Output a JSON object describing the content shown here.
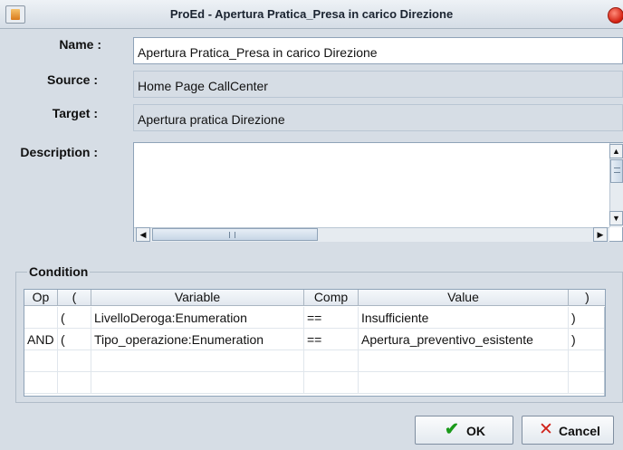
{
  "window": {
    "title": "ProEd - Apertura Pratica_Presa in carico Direzione",
    "icon": "java-cup-icon"
  },
  "form": {
    "name_label": "Name :",
    "name_value": "Apertura Pratica_Presa in carico Direzione",
    "source_label": "Source :",
    "source_value": "Home Page CallCenter",
    "target_label": "Target :",
    "target_value": "Apertura pratica Direzione",
    "description_label": "Description :",
    "description_value": ""
  },
  "condition": {
    "title": "Condition",
    "columns": [
      "Op",
      "(",
      "Variable",
      "Comp",
      "Value",
      ")"
    ],
    "rows": [
      {
        "op": "",
        "open": "(",
        "variable": "LivelloDeroga:Enumeration",
        "comp": "==",
        "value": "Insufficiente",
        "close": ")"
      },
      {
        "op": "AND",
        "open": "(",
        "variable": "Tipo_operazione:Enumeration",
        "comp": "==",
        "value": "Apertura_preventivo_esistente",
        "close": ")"
      },
      {
        "op": "",
        "open": "",
        "variable": "",
        "comp": "",
        "value": "",
        "close": ""
      },
      {
        "op": "",
        "open": "",
        "variable": "",
        "comp": "",
        "value": "",
        "close": ""
      }
    ]
  },
  "buttons": {
    "ok_label": "OK",
    "cancel_label": "Cancel"
  },
  "colors": {
    "ok_check": "#1a9a1a",
    "cancel_x": "#d0221a",
    "window_bg": "#d6dde5"
  }
}
